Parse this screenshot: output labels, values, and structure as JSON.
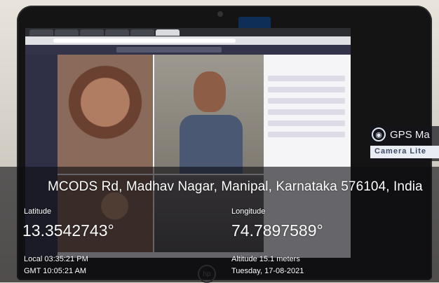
{
  "overlay": {
    "address": "MCODS Rd, Madhav Nagar, Manipal, Karnataka 576104, India",
    "latitude_label": "Latitude",
    "latitude_value": "13.3542743°",
    "longitude_label": "Longitude",
    "longitude_value": "74.7897589°",
    "local_time": "Local 03:35:21 PM",
    "gmt_time": "GMT 10:05:21 AM",
    "altitude": "Altitude 15.1 meters",
    "date": "Tuesday, 17-08-2021"
  },
  "app_brand": {
    "name": "GPS Ma",
    "subtitle": "Camera Lite",
    "icon": "gps-camera-icon"
  },
  "colors": {
    "overlay_band": "#0f0f14",
    "overlay_text": "#ffffff",
    "brand_subtitle": "#3d4a66"
  }
}
